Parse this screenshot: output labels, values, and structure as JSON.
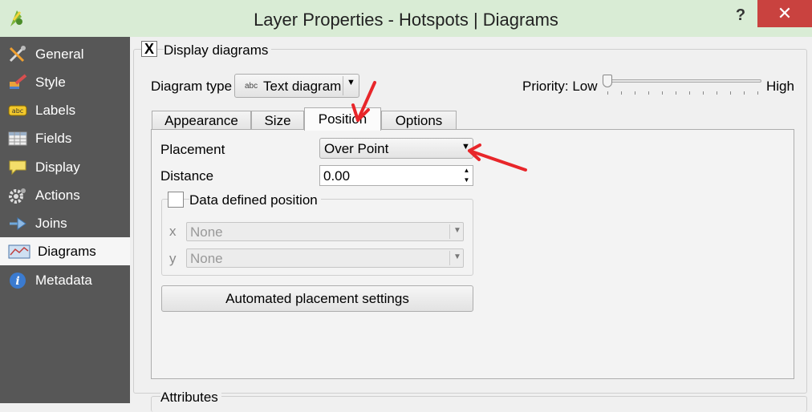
{
  "window": {
    "title": "Layer Properties - Hotspots | Diagrams",
    "help_label": "?",
    "close_label": "✕"
  },
  "sidebar": {
    "items": [
      {
        "label": "General",
        "icon": "tools-icon"
      },
      {
        "label": "Style",
        "icon": "paint-brush-icon"
      },
      {
        "label": "Labels",
        "icon": "abc-label-icon"
      },
      {
        "label": "Fields",
        "icon": "table-icon"
      },
      {
        "label": "Display",
        "icon": "speech-bubble-icon"
      },
      {
        "label": "Actions",
        "icon": "gear-icon"
      },
      {
        "label": "Joins",
        "icon": "join-icon"
      },
      {
        "label": "Diagrams",
        "icon": "diagram-icon",
        "active": true
      },
      {
        "label": "Metadata",
        "icon": "info-icon"
      }
    ]
  },
  "display_diagrams": {
    "label": "Display diagrams",
    "checked": true,
    "mark": "X"
  },
  "diagram_type": {
    "label": "Diagram type",
    "icon_text": "abc",
    "value": "Text diagram"
  },
  "priority": {
    "label": "Priority: Low",
    "high_label": "High",
    "level": 0
  },
  "tabs": [
    {
      "label": "Appearance"
    },
    {
      "label": "Size"
    },
    {
      "label": "Position",
      "active": true
    },
    {
      "label": "Options"
    }
  ],
  "position": {
    "placement_label": "Placement",
    "placement_value": "Over Point",
    "distance_label": "Distance",
    "distance_value": "0.00",
    "ddp_label": "Data defined position",
    "ddp_checked": false,
    "x_label": "x",
    "x_value": "None",
    "y_label": "y",
    "y_value": "None",
    "auto_button": "Automated placement settings"
  },
  "attributes_label": "Attributes",
  "colors": {
    "titlebar": "#d9ecd5",
    "sidebar": "#575757",
    "close": "#c9423f",
    "annotation_arrows": "#e8262a"
  }
}
